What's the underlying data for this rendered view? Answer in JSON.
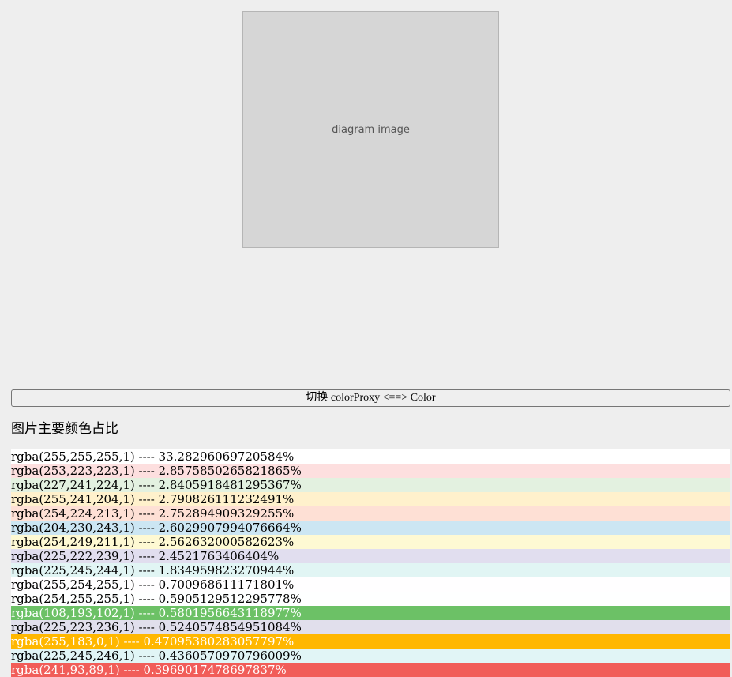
{
  "image": {
    "label": "diagram image"
  },
  "toggle_button": {
    "label": "切换 colorProxy <==> Color"
  },
  "section_title": "图片主要颜色占比",
  "color_rows": [
    {
      "text": "rgba(255,255,255,1) ---- 33.28296069720584%",
      "color": "#ffffff",
      "text_color": "#000000"
    },
    {
      "text": "rgba(253,223,223,1) ---- 2.8575850265821865%",
      "color": "#fddfdf",
      "text_color": "#000000"
    },
    {
      "text": "rgba(227,241,224,1) ---- 2.8405918481295367%",
      "color": "#e3f1e0",
      "text_color": "#000000"
    },
    {
      "text": "rgba(255,241,204,1) ---- 2.790826111232491%",
      "color": "#fff1cc",
      "text_color": "#000000"
    },
    {
      "text": "rgba(254,224,213,1) ---- 2.752894909329255%",
      "color": "#fee0d5",
      "text_color": "#000000"
    },
    {
      "text": "rgba(204,230,243,1) ---- 2.6029907994076664%",
      "color": "#cce6f3",
      "text_color": "#000000"
    },
    {
      "text": "rgba(254,249,211,1) ---- 2.562632000582623%",
      "color": "#fef9d3",
      "text_color": "#000000"
    },
    {
      "text": "rgba(225,222,239,1) ---- 2.4521763406404%",
      "color": "#e1deef",
      "text_color": "#000000"
    },
    {
      "text": "rgba(225,245,244,1) ---- 1.834959823270944%",
      "color": "#e1f5f4",
      "text_color": "#000000"
    },
    {
      "text": "rgba(255,254,255,1) ---- 0.700968611171801%",
      "color": "#fffeff",
      "text_color": "#000000"
    },
    {
      "text": "rgba(254,255,255,1) ---- 0.5905129512295778%",
      "color": "#feffff",
      "text_color": "#000000"
    },
    {
      "text": "rgba(108,193,102,1) ---- 0.5801956643118977%",
      "color": "#6cc166",
      "text_color": "#ffffff"
    },
    {
      "text": "rgba(225,223,236,1) ---- 0.5240574854951084%",
      "color": "#e1dfec",
      "text_color": "#000000"
    },
    {
      "text": "rgba(255,183,0,1) ---- 0.47095380283057797%",
      "color": "#ffb700",
      "text_color": "#ffffff"
    },
    {
      "text": "rgba(225,245,246,1) ---- 0.4360570970796009%",
      "color": "#e1f5f6",
      "text_color": "#000000"
    },
    {
      "text": "rgba(241,93,89,1) ---- 0.3969017478697837%",
      "color": "#f15d59",
      "text_color": "#ffffff"
    }
  ]
}
